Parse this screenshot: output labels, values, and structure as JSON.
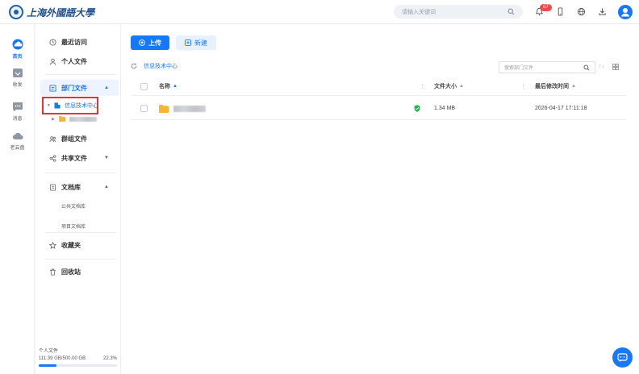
{
  "brand": {
    "name": "上海外國語大學"
  },
  "search": {
    "placeholder": "请输入关键词"
  },
  "notifications": {
    "count": "87"
  },
  "rail": [
    {
      "label": "首页",
      "icon": "cloud-home-icon",
      "active": true
    },
    {
      "label": "收发",
      "icon": "transfer-icon"
    },
    {
      "label": "消息",
      "icon": "message-icon"
    },
    {
      "label": "老云盘",
      "icon": "old-cloud-icon"
    }
  ],
  "sidebar": {
    "recent": "最近访问",
    "personal": "个人文件",
    "department": "部门文件",
    "dept_node": "信息技术中心",
    "group": "群组文件",
    "shared": "共享文件",
    "library": "文档库",
    "library_public": "公共文档库",
    "library_project": "项目文档库",
    "favorites": "收藏夹",
    "recycle": "回收站"
  },
  "quota": {
    "label": "个人文件",
    "used": "111.39 GB/500.00 GB",
    "percent": "22.3%",
    "fraction": 0.223
  },
  "toolbar": {
    "upload": "上传",
    "new": "新建"
  },
  "breadcrumb": {
    "current": "信息技术中心"
  },
  "list_search": {
    "placeholder": "搜索部门文件"
  },
  "table": {
    "columns": {
      "name": "名称",
      "size": "文件大小",
      "modified": "最后修改时间"
    },
    "rows": [
      {
        "size": "1.34 MB",
        "modified": "2026-04-17 17:11:18"
      }
    ]
  },
  "colors": {
    "accent": "#1677ff",
    "highlight": "#e2333a",
    "folder": "#f5b731",
    "badge": "#f04b4b"
  }
}
